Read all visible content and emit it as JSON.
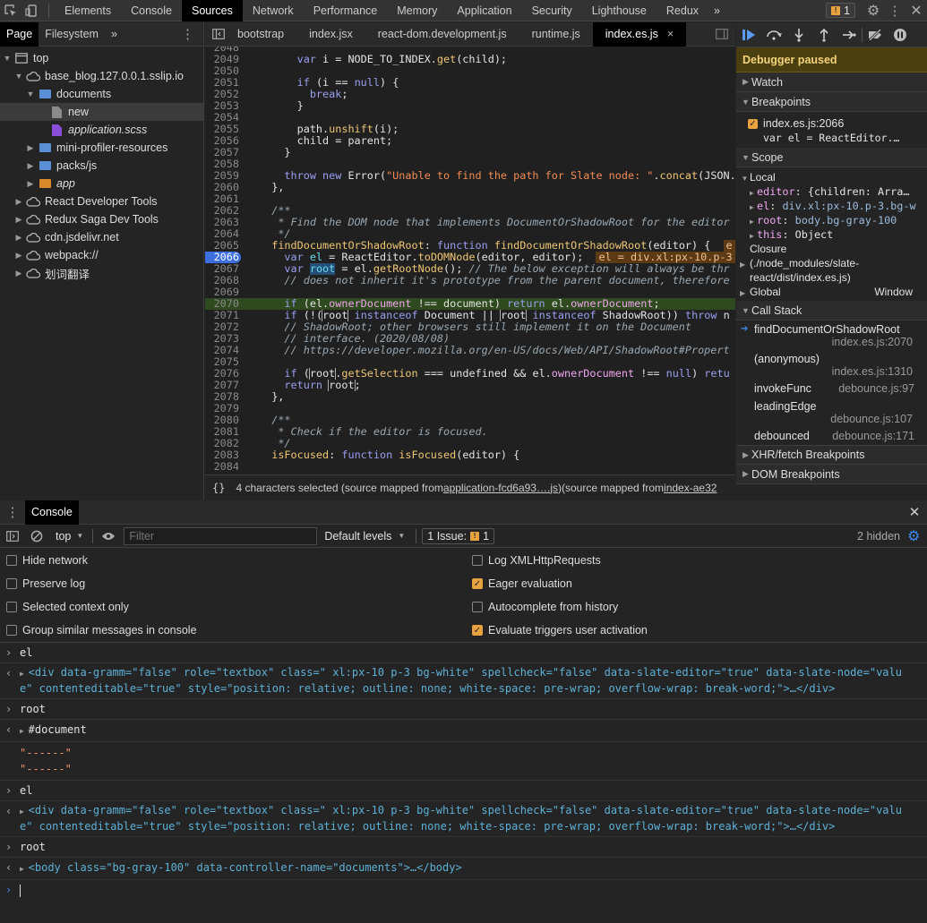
{
  "topbar": {
    "tabs": [
      "Elements",
      "Console",
      "Sources",
      "Network",
      "Performance",
      "Memory",
      "Application",
      "Security",
      "Lighthouse",
      "Redux"
    ],
    "more": "»",
    "issues_count": "1"
  },
  "navigator": {
    "tabs": [
      "Page",
      "Filesystem"
    ],
    "more": "»",
    "tree": [
      {
        "label": "top",
        "depth": 0,
        "arrow": "▼",
        "icon": "frame"
      },
      {
        "label": "base_blog.127.0.0.1.sslip.io",
        "depth": 1,
        "arrow": "▼",
        "icon": "cloud"
      },
      {
        "label": "documents",
        "depth": 2,
        "arrow": "▼",
        "icon": "folder-blue"
      },
      {
        "label": "new",
        "depth": 3,
        "arrow": "",
        "icon": "file-gray",
        "selected": true
      },
      {
        "label": "application.scss",
        "depth": 3,
        "arrow": "",
        "icon": "file-purple",
        "italic": true
      },
      {
        "label": "mini-profiler-resources",
        "depth": 2,
        "arrow": "▶",
        "icon": "folder-blue"
      },
      {
        "label": "packs/js",
        "depth": 2,
        "arrow": "▶",
        "icon": "folder-blue"
      },
      {
        "label": "app",
        "depth": 2,
        "arrow": "▶",
        "icon": "folder-orange",
        "italic": true
      },
      {
        "label": "React Developer Tools",
        "depth": 1,
        "arrow": "▶",
        "icon": "cloud"
      },
      {
        "label": "Redux Saga Dev Tools",
        "depth": 1,
        "arrow": "▶",
        "icon": "cloud"
      },
      {
        "label": "cdn.jsdelivr.net",
        "depth": 1,
        "arrow": "▶",
        "icon": "cloud"
      },
      {
        "label": "webpack://",
        "depth": 1,
        "arrow": "▶",
        "icon": "cloud"
      },
      {
        "label": "划词翻译",
        "depth": 1,
        "arrow": "▶",
        "icon": "cloud"
      }
    ]
  },
  "editor": {
    "tabs": [
      "bootstrap",
      "index.jsx",
      "react-dom.development.js",
      "runtime.js",
      "index.es.js"
    ],
    "active_tab_close": "×",
    "status": {
      "braces": "{}",
      "text": "4 characters selected (source mapped from ",
      "link1": "application-fcd6a93….js",
      "mid": ")(source mapped from ",
      "link2": "index-ae32"
    }
  },
  "debugger": {
    "paused": "Debugger paused",
    "watch": "Watch",
    "breakpoints": "Breakpoints",
    "bp_file": "index.es.js:2066",
    "bp_code": "var el = ReactEditor.…",
    "scope": "Scope",
    "local": "Local",
    "scope_items": [
      {
        "key": "editor",
        "val": "{children: Arra…"
      },
      {
        "key": "el",
        "val": "div.xl:px-10.p-3.bg-w"
      },
      {
        "key": "root",
        "val": "body.bg-gray-100"
      },
      {
        "key": "this",
        "val": "Object"
      }
    ],
    "closure_1": "Closure",
    "closure_2": "(./node_modules/slate-",
    "closure_3": "react/dist/index.es.js)",
    "global": "Global",
    "global_val": "Window",
    "call_stack": "Call Stack",
    "frames": [
      {
        "fn": "findDocumentOrShadowRoot",
        "loc": "index.es.js:2070",
        "current": true
      },
      {
        "fn": "(anonymous)",
        "loc": "index.es.js:1310"
      },
      {
        "fn": "invokeFunc",
        "loc": "debounce.js:97"
      },
      {
        "fn": "leadingEdge",
        "loc": "debounce.js:107"
      },
      {
        "fn": "debounced",
        "loc": "debounce.js:171"
      }
    ],
    "xhr": "XHR/fetch Breakpoints",
    "dom": "DOM Breakpoints"
  },
  "console": {
    "title": "Console",
    "context": "top",
    "filter_placeholder": "Filter",
    "levels": "Default levels",
    "issue_label": "1 Issue:",
    "issue_count": "1",
    "hidden": "2 hidden",
    "settings": [
      {
        "label": "Hide network",
        "checked": false
      },
      {
        "label": "Preserve log",
        "checked": false
      },
      {
        "label": "Selected context only",
        "checked": false
      },
      {
        "label": "Group similar messages in console",
        "checked": false
      },
      {
        "label": "Log XMLHttpRequests",
        "checked": false
      },
      {
        "label": "Eager evaluation",
        "checked": true
      },
      {
        "label": "Autocomplete from history",
        "checked": false
      },
      {
        "label": "Evaluate triggers user activation",
        "checked": true
      }
    ],
    "entries": {
      "in1": "el",
      "div_line1": "<div data-gramm=\"false\" role=\"textbox\" class=\" xl:px-10 p-3 bg-white\" spellcheck=\"false\" data-slate-editor=\"true\" data-slate-node=\"valu",
      "div_line2": "e\" contenteditable=\"true\" style=\"position: relative; outline: none; white-space: pre-wrap; overflow-wrap: break-word;\">…</div>",
      "in2": "root",
      "doc": "#document",
      "log1": "\"------\"",
      "log2": "\"------\"",
      "in3": "el",
      "in4": "root",
      "body": "<body class=\"bg-gray-100\" data-controller-name=\"documents\">…</body>"
    }
  }
}
